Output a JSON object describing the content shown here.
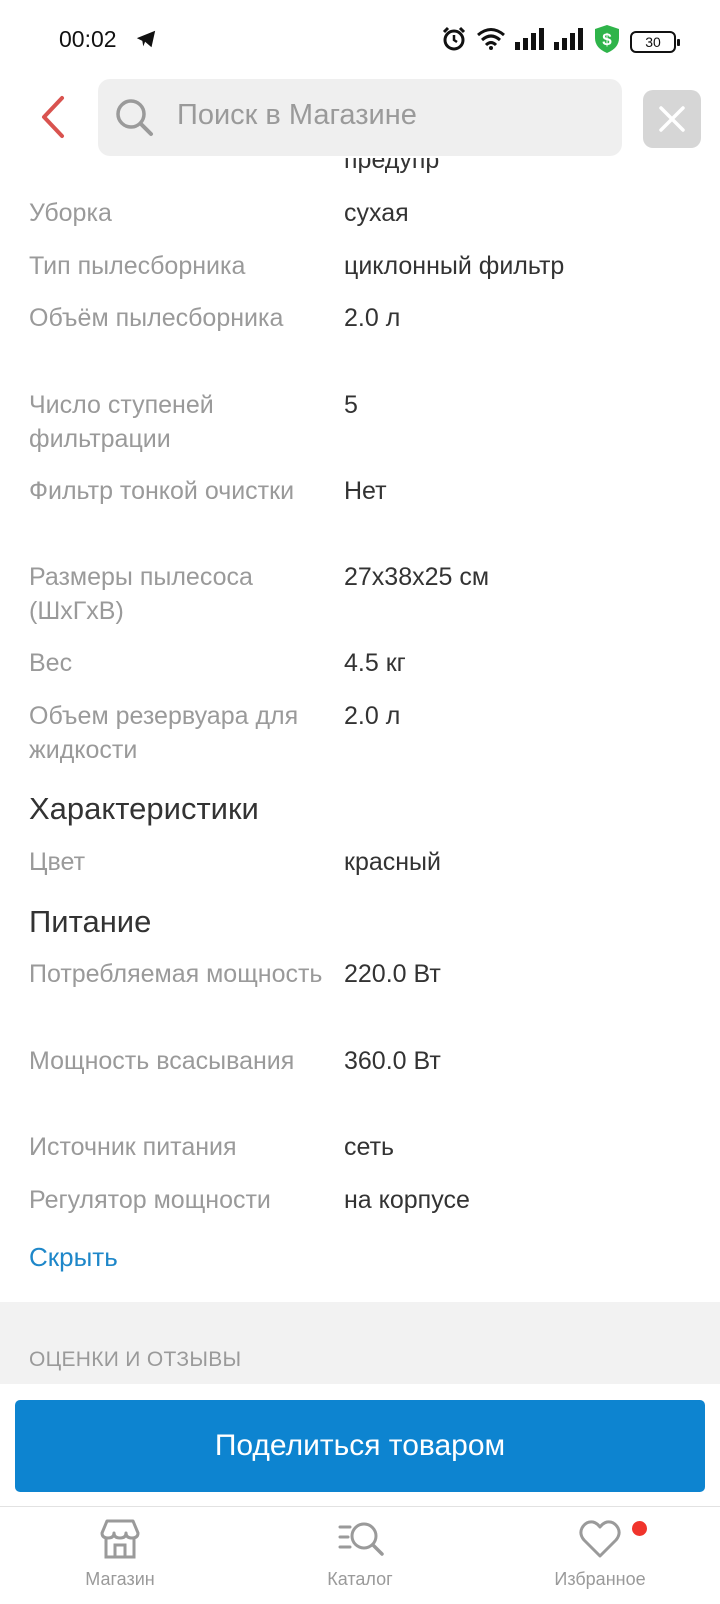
{
  "status": {
    "time": "00:02",
    "battery": "30"
  },
  "search": {
    "placeholder": "Поиск в Магазине"
  },
  "specs_group1": [
    {
      "label": "Уборка",
      "value": "сухая"
    },
    {
      "label": "Тип пылесборника",
      "value": "циклонный фильтр"
    },
    {
      "label": "Объём пылесборника",
      "value": "2.0 л"
    },
    {
      "label": "Число ступеней фильтрации",
      "value": "5"
    },
    {
      "label": "Фильтр тонкой очистки",
      "value": "Нет"
    },
    {
      "label": "Размеры пылесоса (ШхГхВ)",
      "value": "27х38х25 см"
    },
    {
      "label": "Вес",
      "value": "4.5 кг"
    },
    {
      "label": "Объем резервуара для жидкости",
      "value": "2.0 л"
    }
  ],
  "section_characteristics": {
    "title": "Характеристики",
    "rows": [
      {
        "label": "Цвет",
        "value": "красный"
      }
    ]
  },
  "section_power": {
    "title": "Питание",
    "rows": [
      {
        "label": "Потребляемая мощность",
        "value": "220.0 Вт"
      },
      {
        "label": "Мощность всасывания",
        "value": "360.0 Вт"
      },
      {
        "label": "Источник питания",
        "value": "сеть"
      },
      {
        "label": "Регулятор мощности",
        "value": "на корпусе"
      }
    ]
  },
  "hide_link": "Скрыть",
  "reviews_heading": "ОЦЕНКИ И ОТЗЫВЫ",
  "share_button": "Поделиться товаром",
  "nav": [
    {
      "label": "Магазин",
      "icon": "store-icon"
    },
    {
      "label": "Каталог",
      "icon": "catalog-search-icon"
    },
    {
      "label": "Избранное",
      "icon": "heart-icon"
    }
  ],
  "colors": {
    "accent": "#0d84d0",
    "link": "#1e87c9",
    "back_arrow": "#d9534f",
    "badge": "#f0342c"
  }
}
